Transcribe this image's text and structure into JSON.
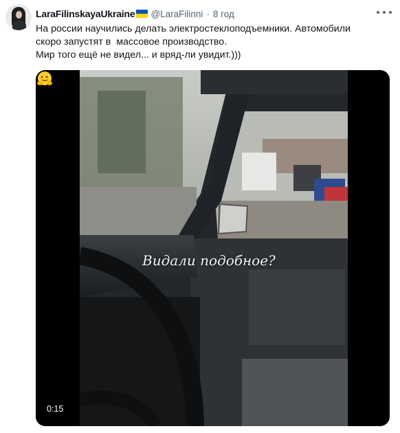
{
  "author": {
    "display_name": "LaraFilinskayaUkraine",
    "handle": "@LaraFilinni",
    "separator": "·",
    "timestamp": "8 год"
  },
  "tweet": {
    "lines": [
      "На россии научились делать электростеклоподъемники. Автомобили",
      "скоро запустят в  массовое производство.",
      "Мир того ещё не видел... и вряд-ли увидит.)))"
    ]
  },
  "video": {
    "caption": "Видали подобное?",
    "duration": "0:15"
  },
  "icons": {
    "flag": "ukraine-flag-icon",
    "more": "more-options-icon",
    "emoji": "hugging-face-emoji-icon"
  },
  "colors": {
    "text": "#0f1419",
    "secondary": "#536471",
    "flag_blue": "#0057b7",
    "flag_yellow": "#ffd700"
  }
}
